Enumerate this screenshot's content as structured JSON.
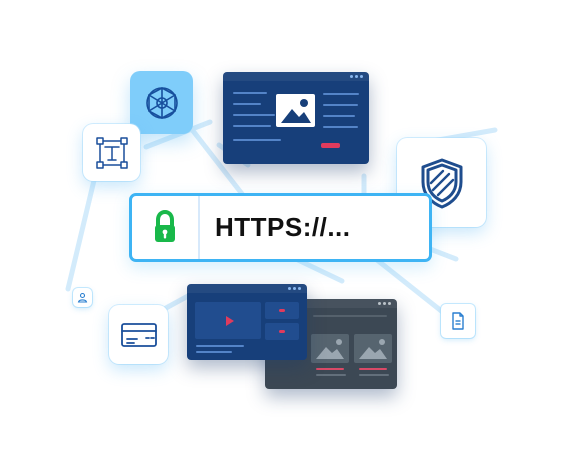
{
  "url_bar": {
    "text": "HTTPS://..."
  },
  "colors": {
    "accent": "#3eb4f4",
    "lock": "#19b84a",
    "navy_window": "#173f7a",
    "slate_window": "#3c4854",
    "pale_tile": "#7fcdfa",
    "shield": "#1f4d8e"
  },
  "icons": [
    "network-node-icon",
    "text-tool-icon",
    "shield-icon",
    "padlock-icon",
    "credit-card-icon",
    "user-badge-icon",
    "document-icon",
    "image-placeholder-icon",
    "play-icon"
  ]
}
